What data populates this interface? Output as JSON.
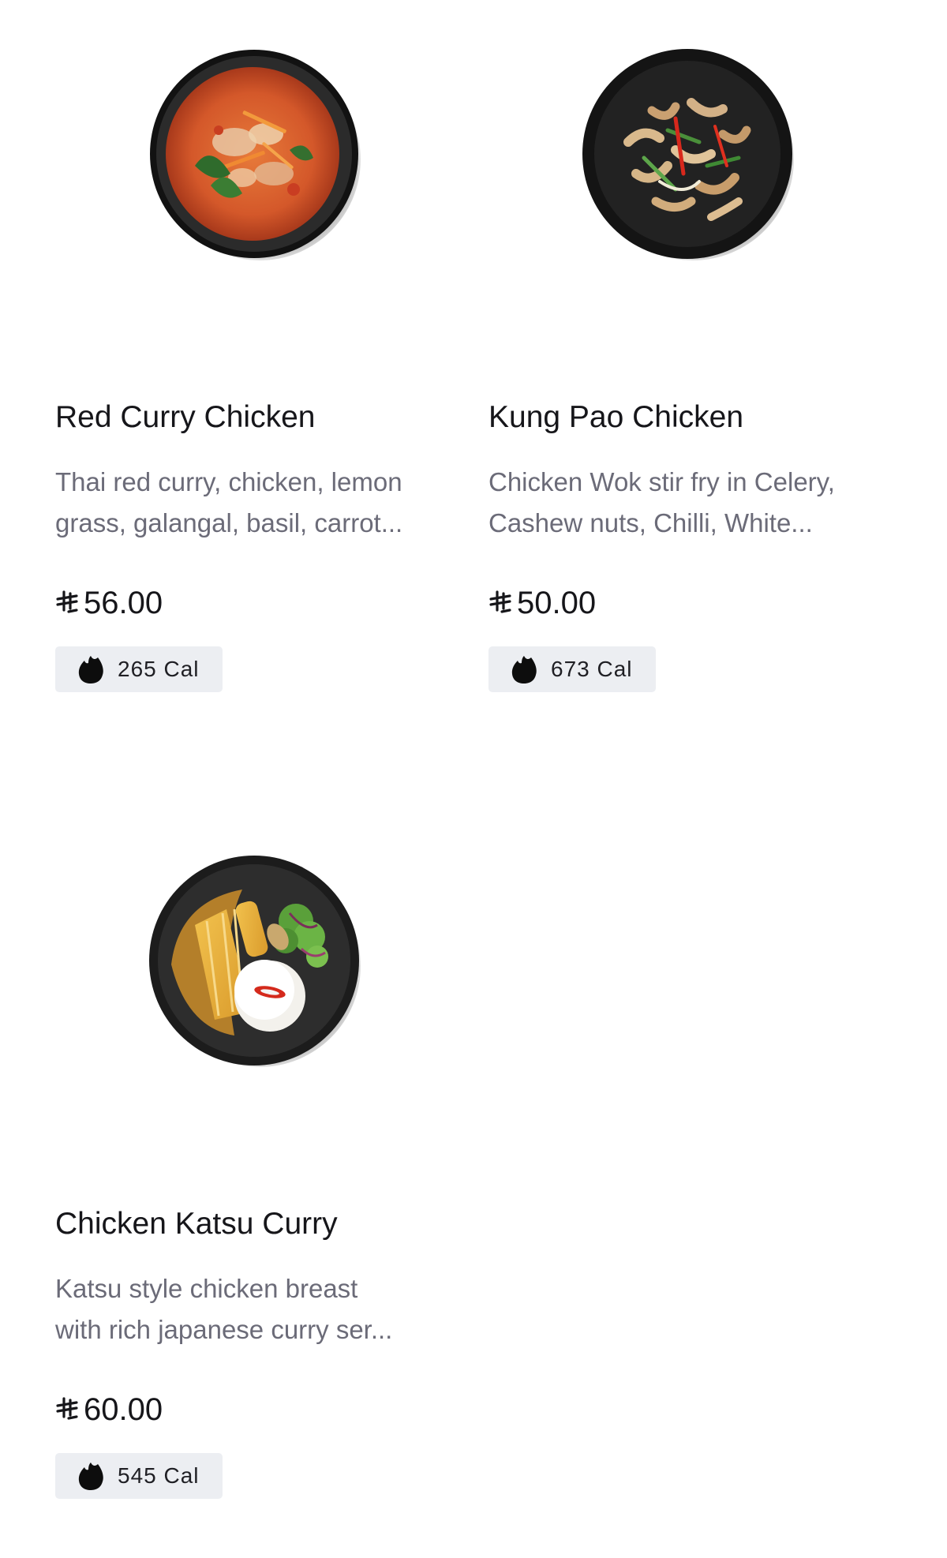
{
  "menu": {
    "items": [
      {
        "name": "Red Curry Chicken",
        "description_lines": [
          "Thai red curry, chicken, lemon",
          "grass, galangal, basil, carrot..."
        ],
        "price": "56.00",
        "calories": "265 Cal",
        "image_icon": "red-curry-bowl"
      },
      {
        "name": "Kung Pao Chicken",
        "description_lines": [
          "Chicken Wok stir fry in Celery,",
          "Cashew nuts, Chilli, White..."
        ],
        "price": "50.00",
        "calories": "673 Cal",
        "image_icon": "stir-fry-plate"
      },
      {
        "name": "Chicken Katsu Curry",
        "description_lines": [
          "Katsu style chicken breast",
          "with rich japanese curry ser..."
        ],
        "price": "60.00",
        "calories": "545 Cal",
        "image_icon": "katsu-curry-plate"
      }
    ],
    "currency_icon": "saudi-riyal-icon",
    "calorie_icon": "flame-icon"
  },
  "colors": {
    "background": "#ffffff",
    "title": "#16161a",
    "description": "#6b6b78",
    "badge_bg": "#eceef2",
    "curry_sauce": "#d8642b",
    "katsu_sauce": "#b9832b",
    "bowl": "#1a1a1a"
  }
}
